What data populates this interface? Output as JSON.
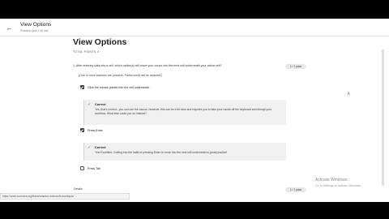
{
  "header": {
    "back_icon": "arrow-left-icon",
    "title": "View Options",
    "subtitle": "Practice Quiz • 15 min"
  },
  "page": {
    "title": "View Options",
    "subtitle": "TOTAL POINTS 4"
  },
  "question": {
    "text": "1.  After entering data into a cell, which option(s) will move your cursor into the next cell underneath your active cell?",
    "points": "1 / 1 point",
    "note": "(One or more answers are possible. Partial credit will be awarded.)"
  },
  "options": [
    {
      "label": "Click the mouse pointer into the cell underneath.",
      "checked": true
    },
    {
      "label": "Press Enter",
      "checked": true
    },
    {
      "label": "Press Tab",
      "checked": false
    }
  ],
  "feedback": [
    {
      "heading": "Correct",
      "body": "Yes, that's correct - you can use the mouse; however, this can be a bit slow and requires you to take your hands off the keyboard and disrupt your workflow. What else could you do instead?"
    },
    {
      "heading": "Correct",
      "body": "Yes! Excellent. Getting into the habit of pressing Enter to move into the next cell underneath is great practice!"
    }
  ],
  "next": {
    "label": "Details",
    "points": "1 / 1 point"
  },
  "status_bar": "https://www.coursera.org/learn/wharton-microsoft-excel/quiz/...",
  "watermark": {
    "title": "Activate Windows",
    "body": "Go to Settings to activate Windows."
  },
  "colors": {
    "check": "#2e8b57",
    "checkbox": "#3c3c3c",
    "feedback_bg": "#f0f0f0"
  }
}
